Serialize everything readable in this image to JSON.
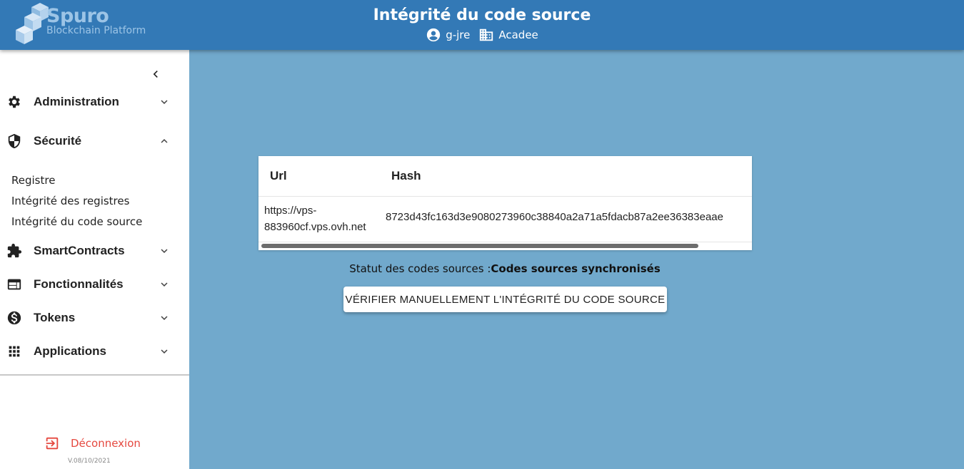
{
  "header": {
    "logo_name": "Spuro",
    "logo_sub": "Blockchain Platform",
    "title": "Intégrité du code source",
    "user": "g-jre",
    "organization": "Acadee",
    "color": "#3379b6"
  },
  "sidebar": {
    "collapse_icon": "chevron-left-icon",
    "items": [
      {
        "label": "Administration",
        "icon": "gear-icon",
        "expanded": false
      },
      {
        "label": "Sécurité",
        "icon": "shield-icon",
        "expanded": true
      },
      {
        "label": "SmartContracts",
        "icon": "puzzle-icon",
        "expanded": false
      },
      {
        "label": "Fonctionnalités",
        "icon": "window-icon",
        "expanded": false
      },
      {
        "label": "Tokens",
        "icon": "dollar-coin-icon",
        "expanded": false
      },
      {
        "label": "Applications",
        "icon": "apps-grid-icon",
        "expanded": false
      }
    ],
    "security_submenu": [
      "Registre",
      "Intégrité des registres",
      "Intégrité du code source"
    ],
    "logout_label": "Déconnexion",
    "version": "V.08/10/2021",
    "logout_color": "#e5483f"
  },
  "table": {
    "headers": [
      "Url",
      "Hash"
    ],
    "rows": [
      {
        "url": "https://vps-883960cf.vps.ovh.net",
        "hash": "8723d43fc163d3e9080273960c38840a2a71a5fdacb87a2ee36383eaae"
      }
    ]
  },
  "status": {
    "label": "Statut des codes sources :",
    "value": "Codes sources synchronisés"
  },
  "verify_button": "VÉRIFIER MANUELLEMENT L'INTÉGRITÉ DU CODE SOURCE",
  "background": "#71a9cc"
}
